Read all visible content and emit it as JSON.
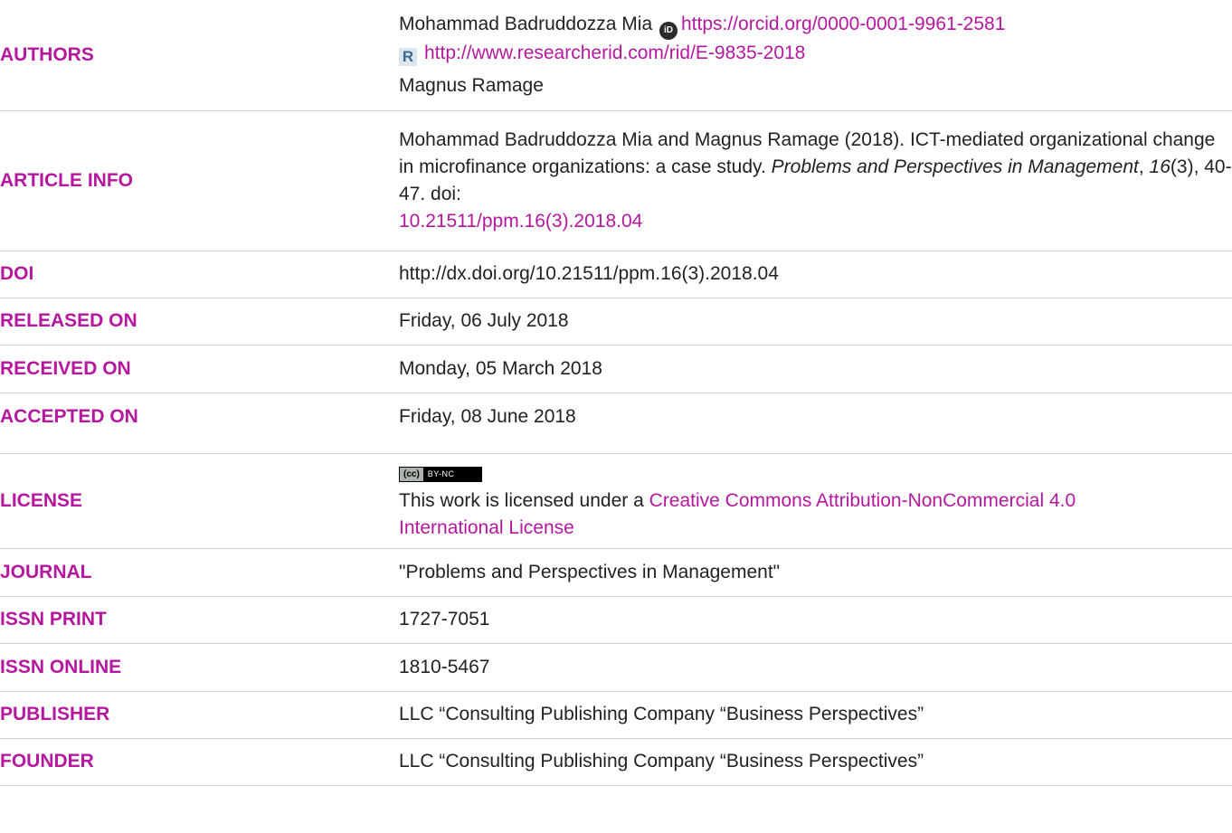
{
  "authors": {
    "label": "AUTHORS",
    "author1_name": "Mohammad Badruddozza Mia",
    "orcid_url": "https://orcid.org/0000-0001-9961-2581",
    "researcherid_url": "http://www.researcherid.com/rid/E-9835-2018",
    "author2_name": "Magnus Ramage",
    "icons": [
      "orcid-icon",
      "researcherid-icon"
    ]
  },
  "article_info": {
    "label": "ARTICLE INFO",
    "citation_authors": "Mohammad Badruddozza Mia and Magnus Ramage (2018). ICT-mediated organizational change in microfinance organizations: a case study. ",
    "journal_title": "Problems and Perspectives in Management",
    "volume": "16",
    "issue_pages": "(3), 40-47. doi:",
    "doi_link": "10.21511/ppm.16(3).2018.04"
  },
  "doi": {
    "label": "DOI",
    "value": "http://dx.doi.org/10.21511/ppm.16(3).2018.04"
  },
  "released_on": {
    "label": "RELEASED ON",
    "value": "Friday, 06 July 2018"
  },
  "received_on": {
    "label": "RECEIVED ON",
    "value": "Monday, 05 March 2018"
  },
  "accepted_on": {
    "label": "ACCEPTED ON",
    "value": "Friday, 08 June 2018"
  },
  "license": {
    "label": "LICENSE",
    "badge_cc": "(cc)",
    "badge_terms": "BY-NC",
    "text_prefix": "This work is licensed under a ",
    "link_text_line1": "Creative Commons Attribution-NonCommercial 4.0",
    "link_text_line2": "International License"
  },
  "journal": {
    "label": "JOURNAL",
    "value": "\"Problems and Perspectives in Management\""
  },
  "issn_print": {
    "label": "ISSN PRINT",
    "value": "1727-7051"
  },
  "issn_online": {
    "label": "ISSN ONLINE",
    "value": "1810-5467"
  },
  "publisher": {
    "label": "PUBLISHER",
    "value": "LLC “Consulting Publishing Company “Business Perspectives”"
  },
  "founder": {
    "label": "FOUNDER",
    "value": "LLC “Consulting Publishing Company “Business Perspectives”"
  },
  "colors": {
    "accent": "#b5179e",
    "text": "#222222",
    "divider": "#cfcfcf"
  }
}
